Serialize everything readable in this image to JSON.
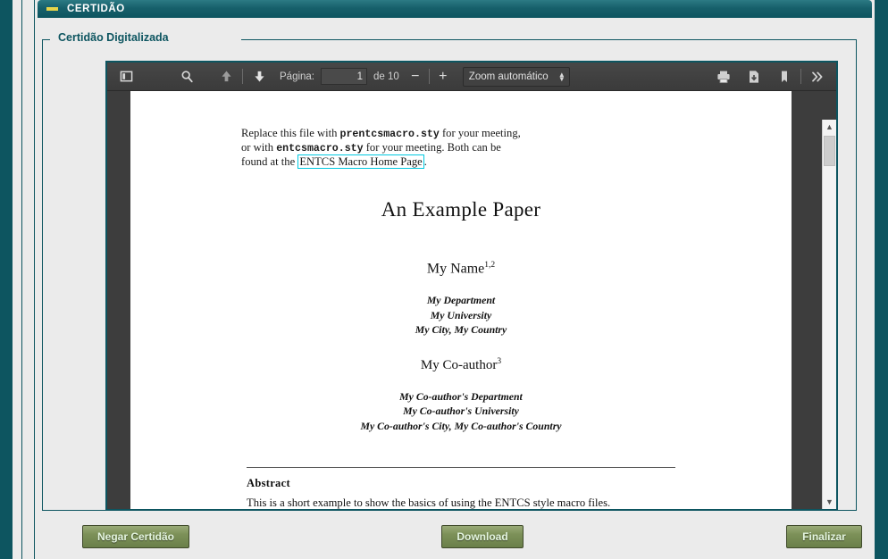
{
  "section": {
    "title": "CERTIDÃO",
    "collapse_icon": "minus-icon"
  },
  "fieldset": {
    "legend": "Certidão Digitalizada"
  },
  "pdf_toolbar": {
    "sidebar_icon": "sidebar-toggle-icon",
    "search_icon": "search-icon",
    "prev_page_icon": "arrow-up-icon",
    "next_page_icon": "arrow-down-icon",
    "page_label": "Página:",
    "page_value": "1",
    "page_total": "de 10",
    "zoom_out": "−",
    "zoom_in": "+",
    "zoom_select_value": "Zoom automático",
    "print_icon": "print-icon",
    "download_icon": "download-icon",
    "bookmark_icon": "bookmark-icon",
    "more_tools_icon": "double-chevron-right-icon"
  },
  "scrollbar": {
    "up_arrow": "▲",
    "down_arrow": "▼"
  },
  "document": {
    "notice_line1_a": "Replace this file with ",
    "notice_line1_mono": "prentcsmacro.sty",
    "notice_line1_b": " for your meeting,",
    "notice_line2_a": "or with ",
    "notice_line2_mono": "entcsmacro.sty",
    "notice_line2_b": " for your meeting. Both can be",
    "notice_line3_a": "found at the ",
    "notice_link": "ENTCS Macro Home Page",
    "notice_line3_b": ".",
    "title": "An Example Paper",
    "author": "My Name",
    "author_sup": "1,2",
    "affiliation": [
      "My Department",
      "My University",
      "My City, My Country"
    ],
    "coauthor": "My Co-author",
    "coauthor_sup": "3",
    "coauthor_affiliation": [
      "My Co-author's Department",
      "My Co-author's University",
      "My Co-author's City, My Co-author's Country"
    ],
    "abstract_heading": "Abstract",
    "abstract_body": "This is a short example to show the basics of using the ENTCS style macro files."
  },
  "buttons": {
    "negar": "Negar Certidão",
    "download": "Download",
    "finalizar": "Finalizar"
  },
  "colors": {
    "teal": "#0d5560",
    "teal_light": "#2c7a84",
    "panel_bg": "#ebebeb",
    "button_green": "#7d9159",
    "toolbar_dark": "#3b3b3b",
    "accent_yellow": "#e8d44a",
    "link_highlight": "#00c8e0"
  }
}
